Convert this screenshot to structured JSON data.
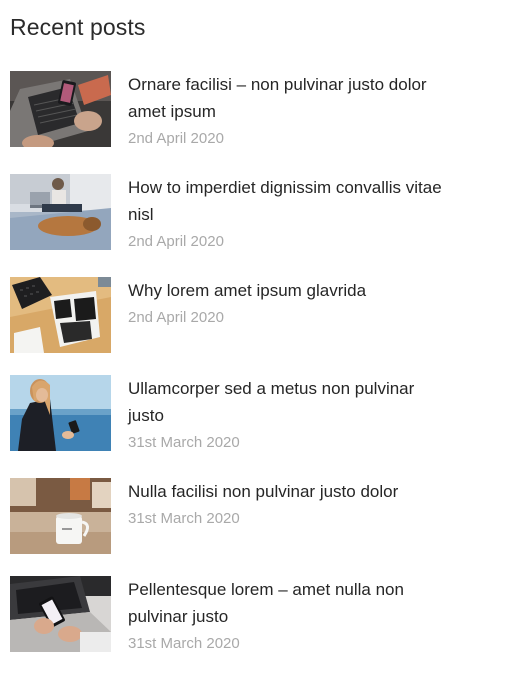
{
  "widget": {
    "title": "Recent posts",
    "posts": [
      {
        "title": "Ornare facilisi – non pulvinar justo dolor amet ipsum",
        "date": "2nd April 2020",
        "thumbnail_icon": "laptop-phone-photo"
      },
      {
        "title": "How to imperdiet dignissim convallis vitae nisl",
        "date": "2nd April 2020",
        "thumbnail_icon": "woman-laptop-dog-photo"
      },
      {
        "title": "Why lorem amet ipsum glavrida",
        "date": "2nd April 2020",
        "thumbnail_icon": "desk-keyboard-photo"
      },
      {
        "title": "Ullamcorper sed a metus non pulvinar justo",
        "date": "31st March 2020",
        "thumbnail_icon": "woman-sea-phone-photo"
      },
      {
        "title": "Nulla facilisi non pulvinar justo dolor",
        "date": "31st March 2020",
        "thumbnail_icon": "coffee-mug-photo"
      },
      {
        "title": "Pellentesque lorem – amet nulla non pulvinar justo",
        "date": "31st March 2020",
        "thumbnail_icon": "hands-phone-laptop-photo"
      }
    ]
  }
}
